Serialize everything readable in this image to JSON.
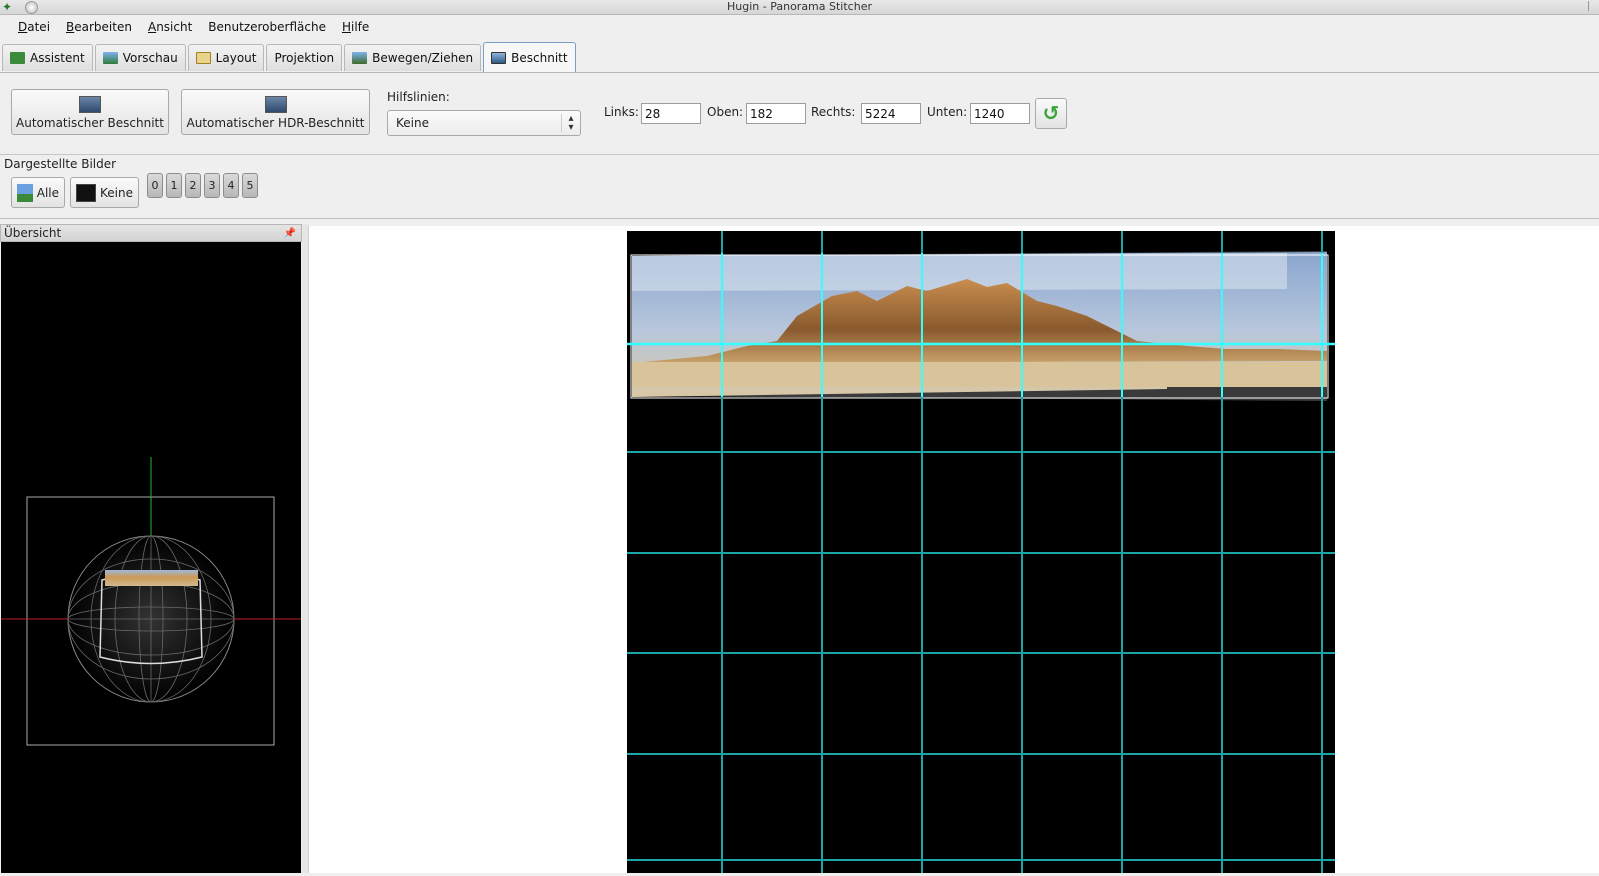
{
  "window": {
    "title": "Hugin - Panorama Stitcher"
  },
  "menu": {
    "items": [
      {
        "acc": "D",
        "rest": "atei"
      },
      {
        "acc": "B",
        "rest": "earbeiten"
      },
      {
        "acc": "A",
        "rest": "nsicht"
      },
      {
        "acc": "",
        "rest": "Benutzeroberfläche"
      },
      {
        "acc": "H",
        "rest": "ilfe"
      }
    ]
  },
  "tabs": [
    {
      "label": "Assistent",
      "icon": "assistant-icon",
      "color": "#3c8a3c"
    },
    {
      "label": "Vorschau",
      "icon": "preview-icon",
      "color": "#5f8fcf"
    },
    {
      "label": "Layout",
      "icon": "layout-icon",
      "color": "#c8a040"
    },
    {
      "label": "Projektion",
      "icon": "",
      "color": ""
    },
    {
      "label": "Bewegen/Ziehen",
      "icon": "move-drag-icon",
      "color": "#4a78b0"
    },
    {
      "label": "Beschnitt",
      "icon": "crop-icon",
      "color": "#3a6a9a",
      "active": true
    }
  ],
  "crop": {
    "auto_crop_label": "Automatischer Beschnitt",
    "auto_hdr_crop_label": "Automatischer HDR-Beschnitt",
    "guides_label": "Hilfslinien:",
    "guides_value": "Keine",
    "left_label": "Links:",
    "left_value": "28",
    "top_label": "Oben:",
    "top_value": "182",
    "right_label": "Rechts:",
    "right_value": "5224",
    "bottom_label": "Unten:",
    "bottom_value": "1240",
    "reset_icon": "reset-icon"
  },
  "displayed_images": {
    "label": "Dargestellte Bilder",
    "all_label": "Alle",
    "none_label": "Keine",
    "numbers": [
      "0",
      "1",
      "2",
      "3",
      "4",
      "5"
    ]
  },
  "overview": {
    "title": "Übersicht",
    "pin_icon": "pin-icon"
  },
  "colors": {
    "grid_cyan": "#1aa6a6",
    "grid_bright": "#33ffff",
    "crop_frame": "#ffffff",
    "horizon_red": "#c0202a",
    "vertical_green": "#2ab52a"
  }
}
